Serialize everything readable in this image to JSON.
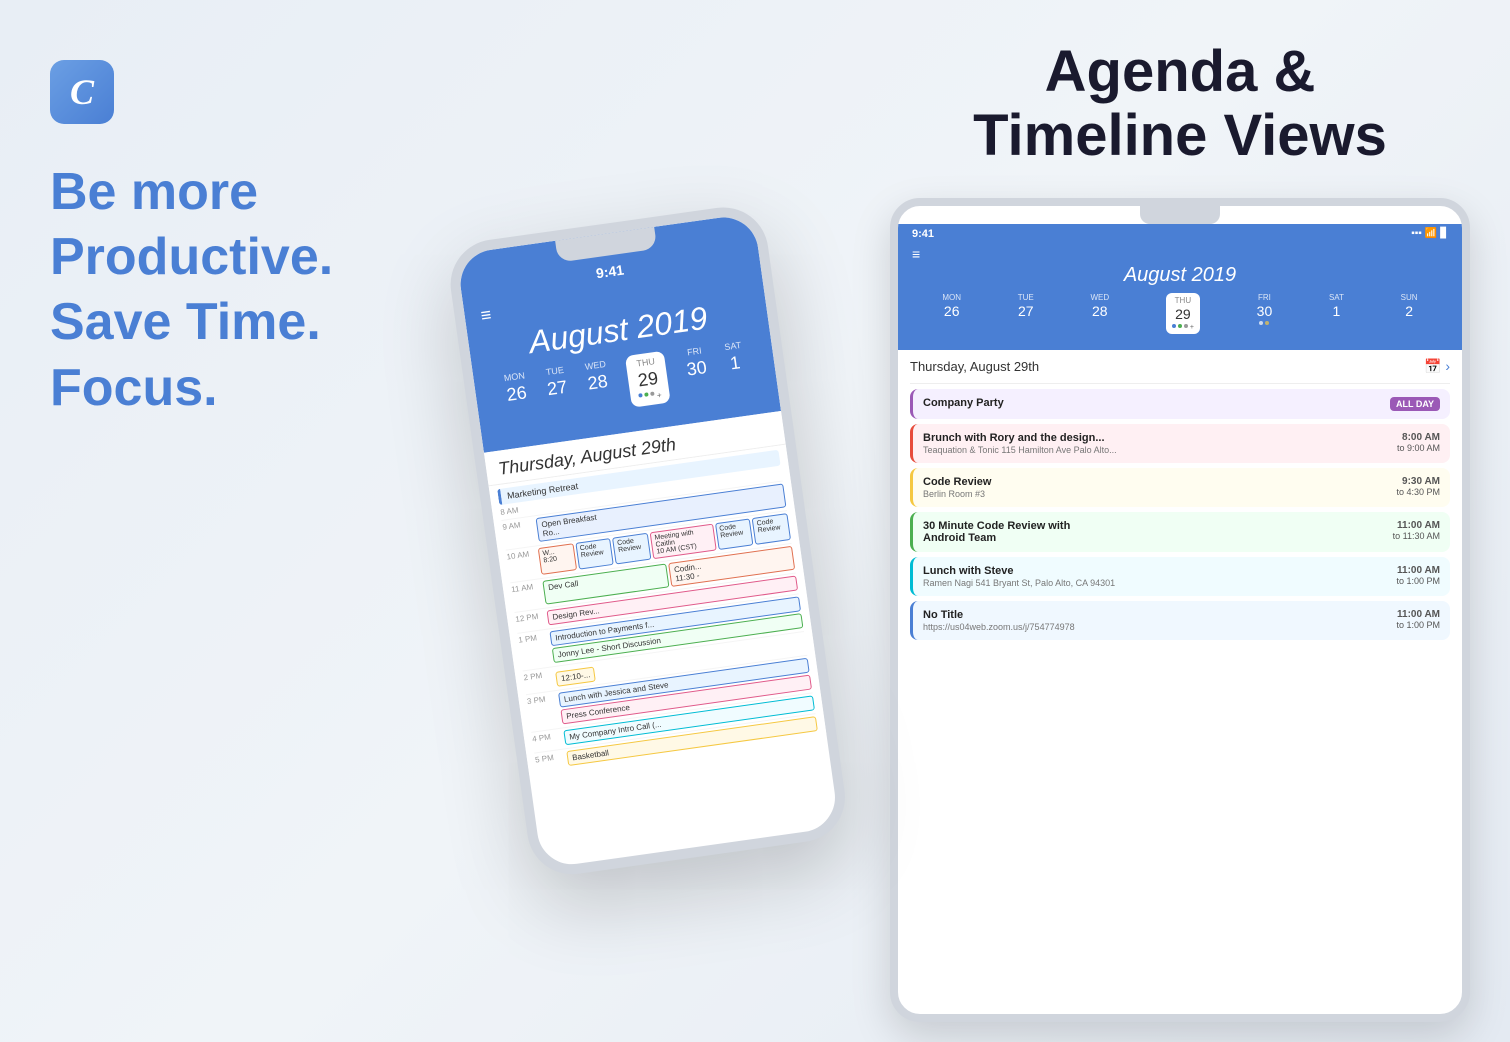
{
  "left": {
    "logo_letter": "C",
    "taglines": [
      "Be more",
      "Productive.",
      "Save Time.",
      "Focus."
    ]
  },
  "middle": {
    "time": "9:41",
    "menu_icon": "≡",
    "month": "August 2019",
    "week_days": [
      "MON",
      "TUE",
      "WED",
      "THU",
      "FRI",
      "SAT"
    ],
    "week_nums": [
      "26",
      "27",
      "28",
      "29",
      "30",
      "1"
    ],
    "selected_day": "29",
    "agenda_date": "Thursday, August 29th",
    "time_slots": [
      {
        "time": "8 AM",
        "events": [
          "Marketing Retreat"
        ]
      },
      {
        "time": "9 AM",
        "events": [
          "Open Breakfast"
        ]
      },
      {
        "time": "10 AM",
        "events": [
          "Work 8:20",
          "Code Review",
          "Code Review",
          "Meeting with Caitlin 10 AM (CST)",
          "Code Review",
          "Code Review",
          "Code Review"
        ]
      },
      {
        "time": "11 AM",
        "events": [
          "Dev Call",
          "Coding 11:30"
        ]
      },
      {
        "time": "12 PM",
        "events": [
          "Design Rev"
        ]
      },
      {
        "time": "1 PM",
        "events": [
          "Introduction to Payments f...",
          "Jonny Lee - Short Discussion"
        ]
      },
      {
        "time": "2 PM",
        "events": [
          "12:10..."
        ]
      },
      {
        "time": "3 PM",
        "events": [
          "Lunch with Jessica and Steve",
          "Press Conference"
        ]
      },
      {
        "time": "4 PM",
        "events": [
          "My Company Intro Call (...."
        ]
      },
      {
        "time": "5 PM",
        "events": [
          "Basketball"
        ]
      }
    ]
  },
  "right": {
    "title_line1": "Agenda &",
    "title_line2": "Timeline Views",
    "phone": {
      "time": "9:41",
      "wifi": "▪▪▪",
      "battery": "▊",
      "menu_icon": "≡",
      "month": "August 2019",
      "week_days": [
        "MON",
        "TUE",
        "WED",
        "THU",
        "FRI",
        "SAT",
        "SUN"
      ],
      "week_nums": [
        "26",
        "27",
        "28",
        "29",
        "30",
        "1",
        "2"
      ],
      "selected_day": "29",
      "agenda_date": "Thursday, August 29th",
      "events": [
        {
          "title": "Company Party",
          "subtitle": "",
          "time": "ALL DAY",
          "time_to": "",
          "card_class": "event-card-purple",
          "badge": true
        },
        {
          "title": "Brunch with Rory and the design...",
          "subtitle": "Teaquation & Tonic 115 Hamilton Ave Palo Alto...",
          "time": "8:00 AM",
          "time_to": "to 9:00 AM",
          "card_class": "event-card-red",
          "badge": false
        },
        {
          "title": "Code Review",
          "subtitle": "Berlin Room #3",
          "time": "9:30 AM",
          "time_to": "to 4:30 PM",
          "card_class": "event-card-yellow-light",
          "badge": false
        },
        {
          "title": "30 Minute Code Review with Android Team",
          "subtitle": "",
          "time": "11:00 AM",
          "time_to": "to 11:30 AM",
          "card_class": "event-card-green-light",
          "badge": false
        },
        {
          "title": "Lunch with Steve",
          "subtitle": "Ramen Nagi 541 Bryant St, Palo Alto, CA 94301",
          "time": "11:00 AM",
          "time_to": "to 1:00 PM",
          "card_class": "event-card-cyan",
          "badge": false
        },
        {
          "title": "No Title",
          "subtitle": "https://us04web.zoom.us/j/754774978",
          "time": "11:00 AM",
          "time_to": "to 1:00 PM",
          "card_class": "event-card-blue-light",
          "badge": false
        }
      ]
    }
  }
}
